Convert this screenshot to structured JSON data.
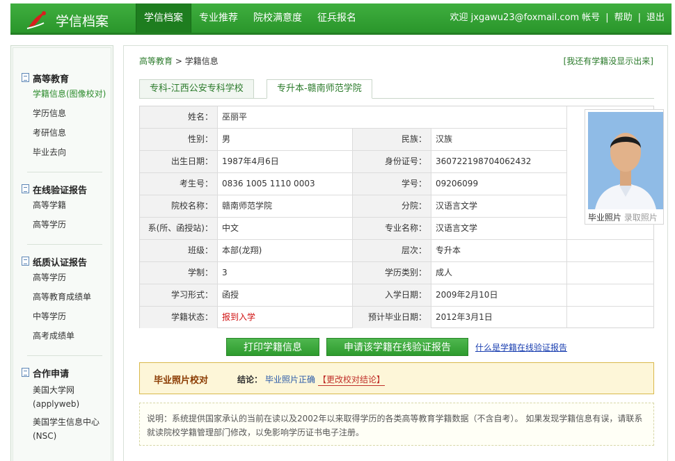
{
  "header": {
    "brand": "学信档案",
    "nav": [
      "学信档案",
      "专业推荐",
      "院校满意度",
      "征兵报名"
    ],
    "welcome": "欢迎 jxgawu23@foxmail.com",
    "account": "帐号",
    "help": "帮助",
    "logout": "退出",
    "separator": "|"
  },
  "sidebar": {
    "sections": [
      {
        "title": "高等教育",
        "items": [
          "学籍信息(图像校对)",
          "学历信息",
          "考研信息",
          "毕业去向"
        ]
      },
      {
        "title": "在线验证报告",
        "items": [
          "高等学籍",
          "高等学历"
        ]
      },
      {
        "title": "纸质认证报告",
        "items": [
          "高等学历",
          "高等教育成绩单",
          "中等学历",
          "高考成绩单"
        ]
      },
      {
        "title": "合作申请",
        "items": [
          "美国大学网(applyweb)",
          "美国学生信息中心(NSC)"
        ]
      }
    ]
  },
  "main": {
    "breadcrumb": {
      "root": "高等教育",
      "arrow": ">",
      "current": "学籍信息"
    },
    "report_link": "[我还有学籍没显示出来]",
    "tabs": [
      "专科-江西公安专科学校",
      "专升本-赣南师范学院"
    ],
    "info": {
      "name_label": "姓名：",
      "name": "巫丽平",
      "rows": [
        {
          "l1": "性别：",
          "v1": "男",
          "l2": "民族：",
          "v2": "汉族"
        },
        {
          "l1": "出生日期：",
          "v1": "1987年4月6日",
          "l2": "身份证号：",
          "v2": "360722198704062432"
        },
        {
          "l1": "考生号：",
          "v1": "0836 1005 1110 0003",
          "l2": "学号：",
          "v2": "09206099"
        },
        {
          "l1": "院校名称：",
          "v1": "赣南师范学院",
          "l2": "分院：",
          "v2": "汉语言文学"
        },
        {
          "l1": "系(所、函授站)：",
          "v1": "中文",
          "l2": "专业名称：",
          "v2": "汉语言文学"
        },
        {
          "l1": "班级：",
          "v1": "本部(龙翔)",
          "l2": "层次：",
          "v2": "专升本"
        },
        {
          "l1": "学制：",
          "v1": "3",
          "l2": "学历类别：",
          "v2": "成人"
        },
        {
          "l1": "学习形式：",
          "v1": "函授",
          "l2": "入学日期：",
          "v2": "2009年2月10日"
        },
        {
          "l1": "学籍状态：",
          "v1": "报到入学",
          "l2": "预计毕业日期：",
          "v2": "2012年3月1日"
        }
      ],
      "photo_caption": "毕业照片",
      "photo_caption_extra": "录取照片"
    },
    "buttons": {
      "print": "打印学籍信息",
      "apply": "申请该学籍在线验证报告"
    },
    "help_link": "什么是学籍在线验证报告",
    "verify": {
      "title": "毕业照片校对",
      "label": "结论：",
      "ok": "毕业照片正确",
      "change": "【更改校对结论】"
    },
    "note": "说明：系统提供国家承认的当前在读以及2002年以来取得学历的各类高等教育学籍数据（不含自考）。 如果发现学籍信息有误，请联系就读院校学籍管理部门修改，以免影响学历证书电子注册。"
  },
  "colors": {
    "accent": "#2a962b",
    "status_red": "#d01010"
  }
}
